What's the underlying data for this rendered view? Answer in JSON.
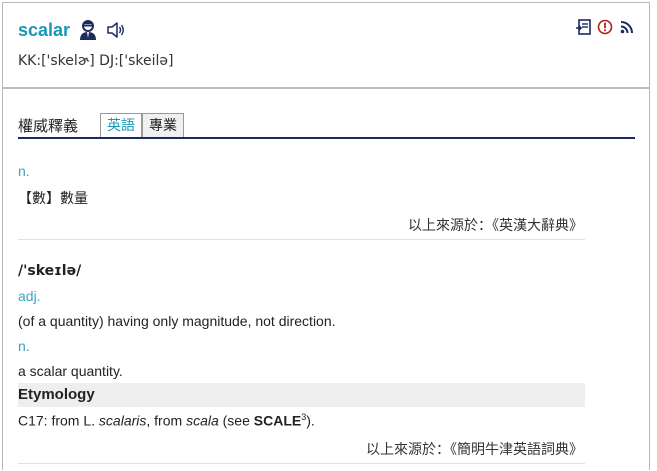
{
  "header": {
    "word": "scalar",
    "pronunciation": "KK:['skelɚ] DJ:['skeilə]",
    "icons": [
      "teacher-icon",
      "sound-icon",
      "notebook-icon",
      "report-icon",
      "rss-icon"
    ]
  },
  "tabs": {
    "title": "權威釋義",
    "items": [
      {
        "label": "英語",
        "active": true
      },
      {
        "label": "專業",
        "active": false
      }
    ]
  },
  "entry1": {
    "pos": "n.",
    "definition": "【數】數量",
    "source": "以上來源於：《英漢大辭典》"
  },
  "entry2": {
    "phonetic": "/'skeɪlə/",
    "pos1": "adj.",
    "def1": "(of a quantity) having only magnitude, not direction.",
    "pos2": "n.",
    "def2": "a scalar quantity.",
    "etymology_title": "Etymology",
    "etymology": {
      "prefix": "C17: from L. ",
      "italic1": "scalaris",
      "middle": ", from ",
      "italic2": "scala",
      "see": " (see ",
      "ref": "SCALE",
      "ref_sup": "3",
      "suffix": ")."
    },
    "source": "以上來源於：《簡明牛津英語詞典》"
  },
  "colors": {
    "accent": "#1a97b4",
    "pos": "#3aa6c0",
    "tab_underline": "#1b2a5c"
  }
}
